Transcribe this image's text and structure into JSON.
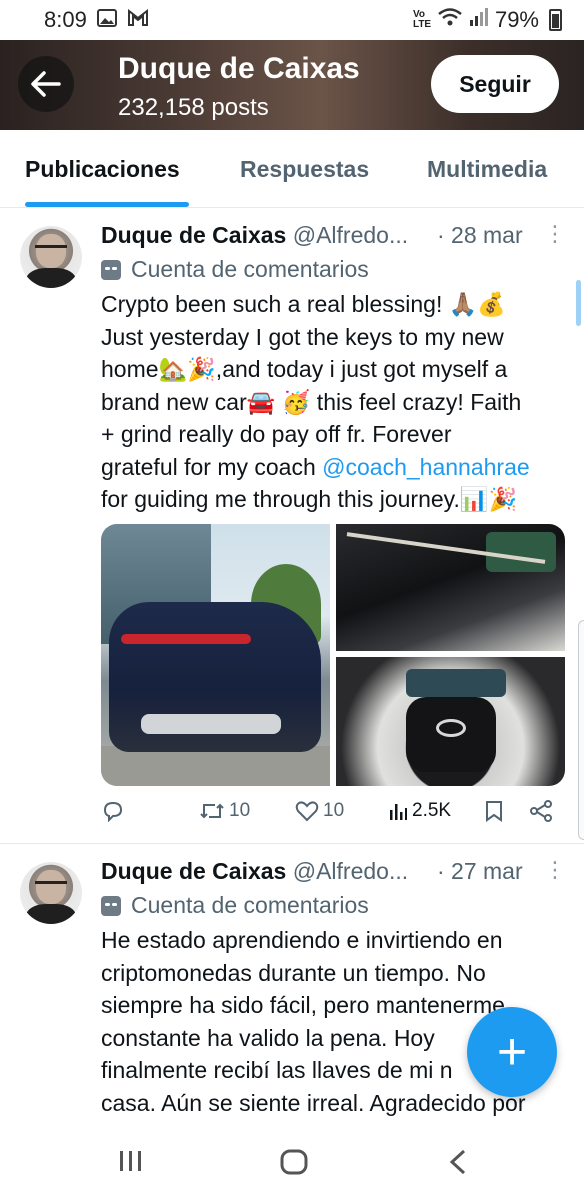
{
  "status_bar": {
    "time": "8:09",
    "network": "Vo LTE",
    "battery": "79%"
  },
  "header": {
    "title": "Duque de Caixas",
    "subtitle": "232,158 posts",
    "follow_label": "Seguir"
  },
  "tabs": [
    {
      "label": "Publicaciones",
      "active": true
    },
    {
      "label": "Respuestas",
      "active": false
    },
    {
      "label": "Multimedia",
      "active": false
    }
  ],
  "posts": [
    {
      "name": "Duque de Caixas",
      "handle": "@Alfredo...",
      "date": "· 28 mar",
      "label": "Cuenta de comentarios",
      "text_lines": [
        "Crypto been such a real blessing! 🙏🏽💰",
        "Just yesterday I got the keys to my new",
        "home🏡🎉,and today i just got myself a",
        "brand new car🚘 🥳 this feel crazy! Faith",
        "+ grind really do pay off fr. Forever",
        "grateful for my coach "
      ],
      "mention": "@coach_hannahrae",
      "text_last": "for guiding me through this journey.📊🎉",
      "stats": {
        "retweets": "10",
        "likes": "10",
        "views": "2.5K"
      }
    },
    {
      "name": "Duque de Caixas",
      "handle": "@Alfredo...",
      "date": "· 27 mar",
      "label": "Cuenta de comentarios",
      "text_lines": [
        "He estado aprendiendo e invirtiendo en",
        "criptomonedas durante un tiempo. No",
        "siempre ha sido fácil, pero mantenerme",
        "constante ha valido la pena. Hoy",
        "finalmente recibí las llaves de mi n",
        "casa. Aún se siente irreal. Agradecido por"
      ]
    }
  ],
  "fab": {
    "icon": "plus-icon",
    "label": "+"
  },
  "colors": {
    "accent": "#1d9bf0",
    "text": "#0f1419",
    "muted": "#536471"
  }
}
